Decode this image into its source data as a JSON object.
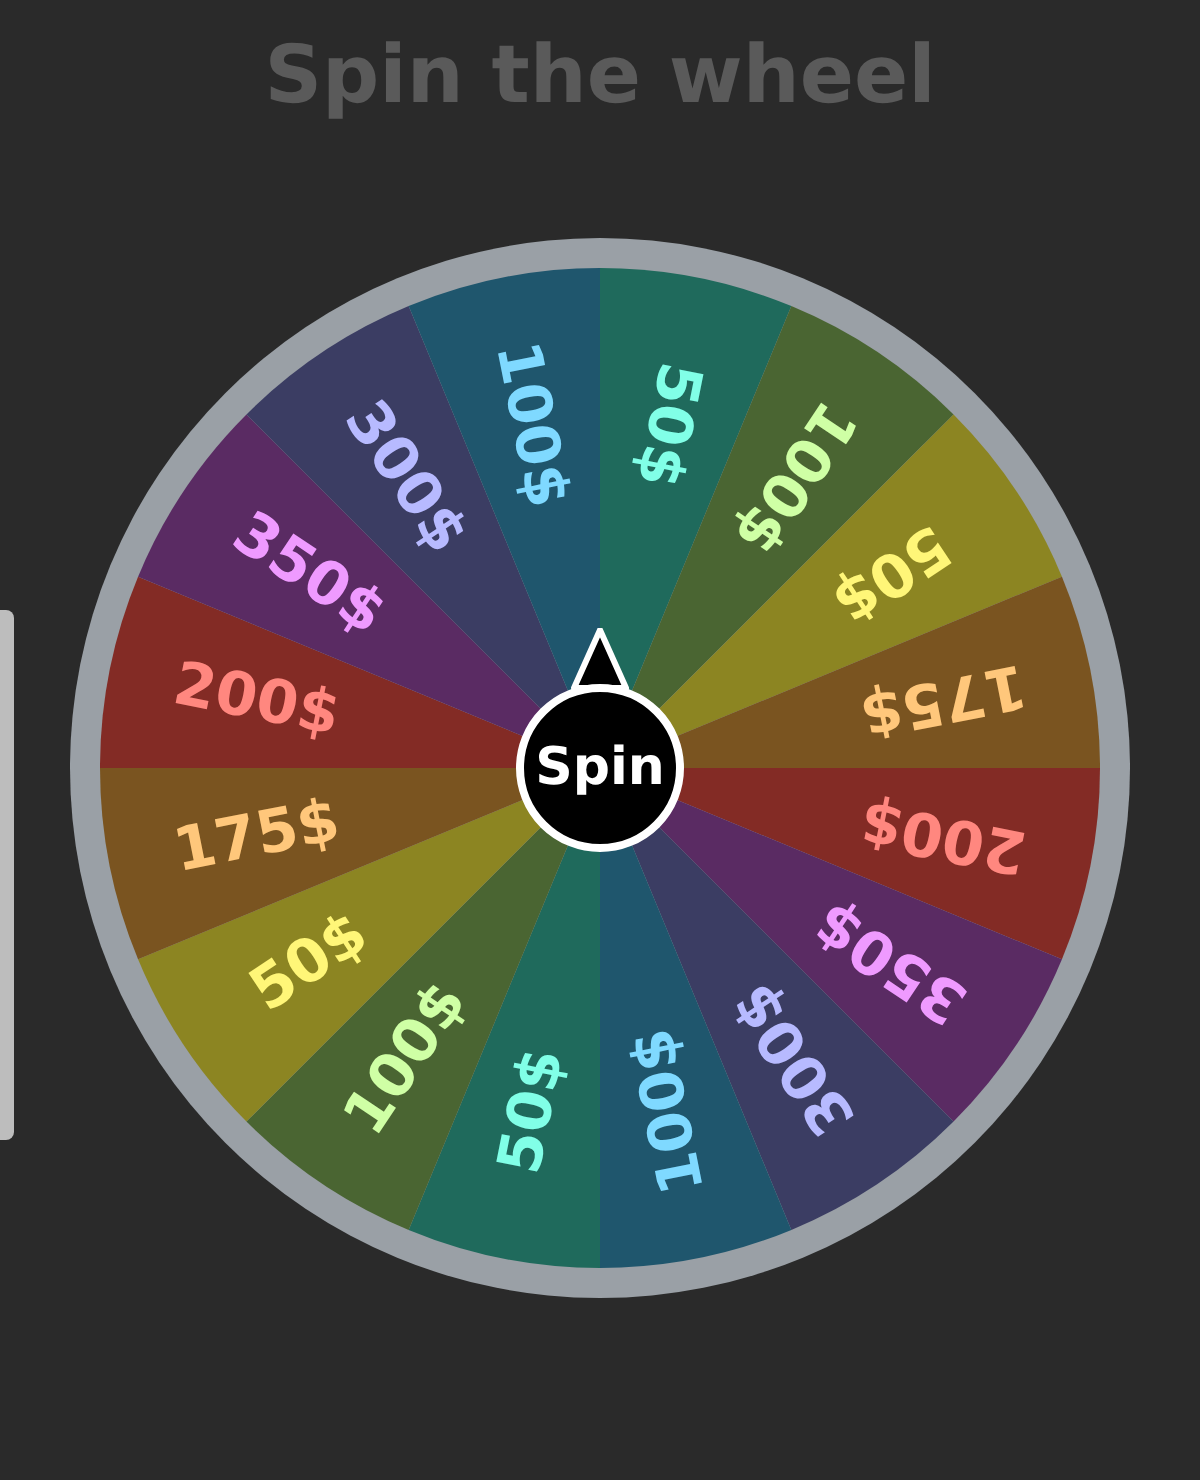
{
  "title": "Spin the wheel",
  "segments": [
    {
      "label": "50$",
      "color": "#1f6a5c"
    },
    {
      "label": "100$",
      "color": "#4a6532"
    },
    {
      "label": "50$",
      "color": "#8c8522"
    },
    {
      "label": "175$",
      "color": "#7a5420"
    },
    {
      "label": "200$",
      "color": "#832b25"
    },
    {
      "label": "350$",
      "color": "#5a2b63"
    },
    {
      "label": "300$",
      "color": "#3b3d63"
    },
    {
      "label": "100$",
      "color": "#1f566d"
    },
    {
      "label": "50$",
      "color": "#1f6a5c"
    },
    {
      "label": "100$",
      "color": "#4a6532"
    },
    {
      "label": "50$",
      "color": "#8c8522"
    },
    {
      "label": "175$",
      "color": "#7a5420"
    },
    {
      "label": "200$",
      "color": "#832b25"
    },
    {
      "label": "350$",
      "color": "#5a2b63"
    },
    {
      "label": "300$",
      "color": "#3b3d63"
    },
    {
      "label": "100$",
      "color": "#1f566d"
    }
  ],
  "spin_button": {
    "label": "Spin"
  }
}
